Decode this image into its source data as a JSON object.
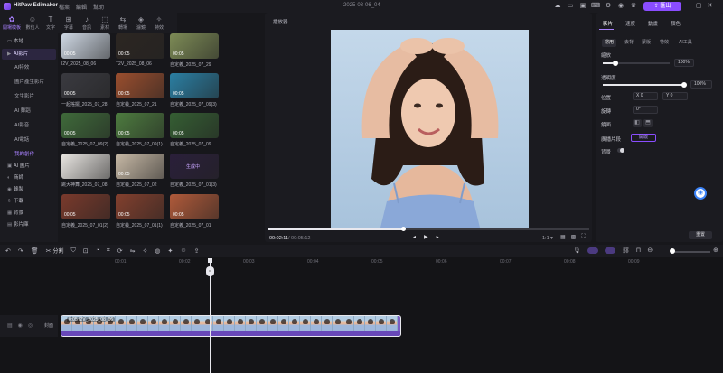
{
  "titlebar": {
    "app_name": "HitPaw Edimakor",
    "menu": [
      "檔案",
      "編輯",
      "幫助"
    ],
    "project_name": "2025-08-06_04",
    "export_label": "匯出"
  },
  "topnav": [
    {
      "label": "開場模板",
      "icon": "template-icon",
      "active": true
    },
    {
      "label": "數位人",
      "icon": "avatar-icon"
    },
    {
      "label": "文字",
      "icon": "text-icon"
    },
    {
      "label": "字幕",
      "icon": "subtitle-icon"
    },
    {
      "label": "音訊",
      "icon": "audio-icon"
    },
    {
      "label": "素材",
      "icon": "asset-icon"
    },
    {
      "label": "轉場",
      "icon": "transition-icon"
    },
    {
      "label": "濾鏡",
      "icon": "filter-icon"
    },
    {
      "label": "特效",
      "icon": "effect-icon"
    }
  ],
  "sidebar": {
    "items": [
      {
        "label": "本地",
        "icon": "folder-icon"
      },
      {
        "label": "AI影片",
        "icon": "ai-video-icon",
        "active": true
      },
      {
        "label": "AI 圖片",
        "icon": "ai-image-icon"
      },
      {
        "label": "商師",
        "icon": "stock-icon"
      },
      {
        "label": "錄製",
        "icon": "record-icon"
      },
      {
        "label": "下載",
        "icon": "download-icon"
      },
      {
        "label": "背景",
        "icon": "background-icon"
      },
      {
        "label": "影片庫",
        "icon": "library-icon"
      }
    ],
    "subitems": [
      {
        "label": "AI特效"
      },
      {
        "label": "圖片產生影片"
      },
      {
        "label": "文生影片"
      },
      {
        "label": "AI 舞蹈"
      },
      {
        "label": "AI影音"
      },
      {
        "label": "AI電話"
      },
      {
        "label": "我的創作",
        "active": true
      }
    ]
  },
  "media": [
    {
      "label": "I2V_2025_08_06",
      "duration": "00:05",
      "bg": "#cfd8e4"
    },
    {
      "label": "T2V_2025_08_06",
      "duration": "00:05",
      "bg": "#2c2622"
    },
    {
      "label": "自定義_2025_07_29",
      "duration": "00:05",
      "bg": "#7d8b56"
    },
    {
      "label": "一起搖擺_2025_07_28",
      "duration": "00:05",
      "bg": "#3a3a40"
    },
    {
      "label": "自定義_2025_07_21",
      "duration": "00:05",
      "bg": "#9a4e2e"
    },
    {
      "label": "自定義_2025_07_09(3)",
      "duration": "00:05",
      "bg": "#2b7fa3"
    },
    {
      "label": "自定義_2025_07_09(2)",
      "duration": "00:05",
      "bg": "#3f6a3a"
    },
    {
      "label": "自定義_2025_07_09(1)",
      "duration": "00:05",
      "bg": "#4d7b3f"
    },
    {
      "label": "自定義_2025_07_09",
      "duration": "00:05",
      "bg": "#355e33"
    },
    {
      "label": "跳大神舞_2025_07_08",
      "duration": "",
      "bg": "#e9e6e2"
    },
    {
      "label": "自定義_2025_07_02",
      "duration": "00:05",
      "bg": "#c7b9a6"
    },
    {
      "label": "自定義_2025_07_01(3)",
      "duration": "",
      "bg": "#2a1f3a",
      "overlay": "生成中"
    },
    {
      "label": "自定義_2025_07_01(2)",
      "duration": "00:05",
      "bg": "#7a3a2c"
    },
    {
      "label": "自定義_2025_07_01(1)",
      "duration": "00:05",
      "bg": "#83402e"
    },
    {
      "label": "自定義_2025_07_01",
      "duration": "00:05",
      "bg": "#b05a3a"
    }
  ],
  "player": {
    "title": "播放器",
    "time_current": "00:02:11",
    "time_total": "/ 00:05:12",
    "progress": 0.42,
    "ratio": "1:1"
  },
  "right_panel": {
    "tabs": [
      "影片",
      "速度",
      "動畫",
      "顏色"
    ],
    "subtabs": [
      "常用",
      "去背",
      "蒙版",
      "特效",
      "AI工具"
    ],
    "scale_label": "縮放",
    "scale_value": "100%",
    "scale_level": 1.0,
    "opacity_label": "透明度",
    "opacity_value": "100%",
    "opacity_level": 1.0,
    "position_label": "位置",
    "pos_x": "X  0",
    "pos_y": "Y  0",
    "rotate_label": "旋轉",
    "rotate_value": "0°",
    "flip_label": "鏡面",
    "cut_label": "廣播片段",
    "cut_button": "開啟",
    "bg_label": "背景",
    "reset_label": "重置"
  },
  "timeline": {
    "split_label": "分割",
    "ruler_ticks": [
      "00:01",
      "00:02",
      "00:03",
      "00:04",
      "00:05",
      "00:06",
      "00:07",
      "00:08",
      "00:09"
    ],
    "track_label": "封面",
    "clip_label": "0:05 I2V_2025_08_06",
    "clip_frames": 31
  },
  "colors": {
    "accent": "#8a4dff",
    "accent_light": "#a981ff"
  }
}
